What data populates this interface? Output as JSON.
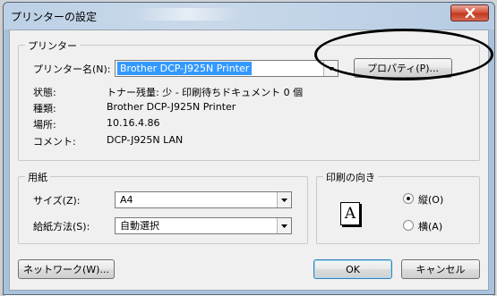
{
  "window": {
    "title": "プリンターの設定"
  },
  "printer_group": {
    "label": "プリンター",
    "name_label": "プリンター名(N):",
    "name_value": "Brother DCP-J925N Printer",
    "properties_button": "プロパティ(P)...",
    "status_label": "状態:",
    "status_value": "トナー残量: 少 - 印刷待ちドキュメント 0 個",
    "type_label": "種類:",
    "type_value": "Brother DCP-J925N Printer",
    "location_label": "場所:",
    "location_value": "10.16.4.86",
    "comment_label": "コメント:",
    "comment_value": "DCP-J925N LAN"
  },
  "paper_group": {
    "label": "用紙",
    "size_label": "サイズ(Z):",
    "size_value": "A4",
    "source_label": "給紙方法(S):",
    "source_value": "自動選択"
  },
  "orientation_group": {
    "label": "印刷の向き",
    "icon_letter": "A",
    "portrait_label": "縦(O)",
    "landscape_label": "横(A)",
    "selected": "portrait"
  },
  "buttons": {
    "network": "ネットワーク(W)...",
    "ok": "OK",
    "cancel": "キャンセル"
  },
  "icons": [
    "close-icon",
    "dropdown-arrow-icon",
    "orientation-icon"
  ]
}
